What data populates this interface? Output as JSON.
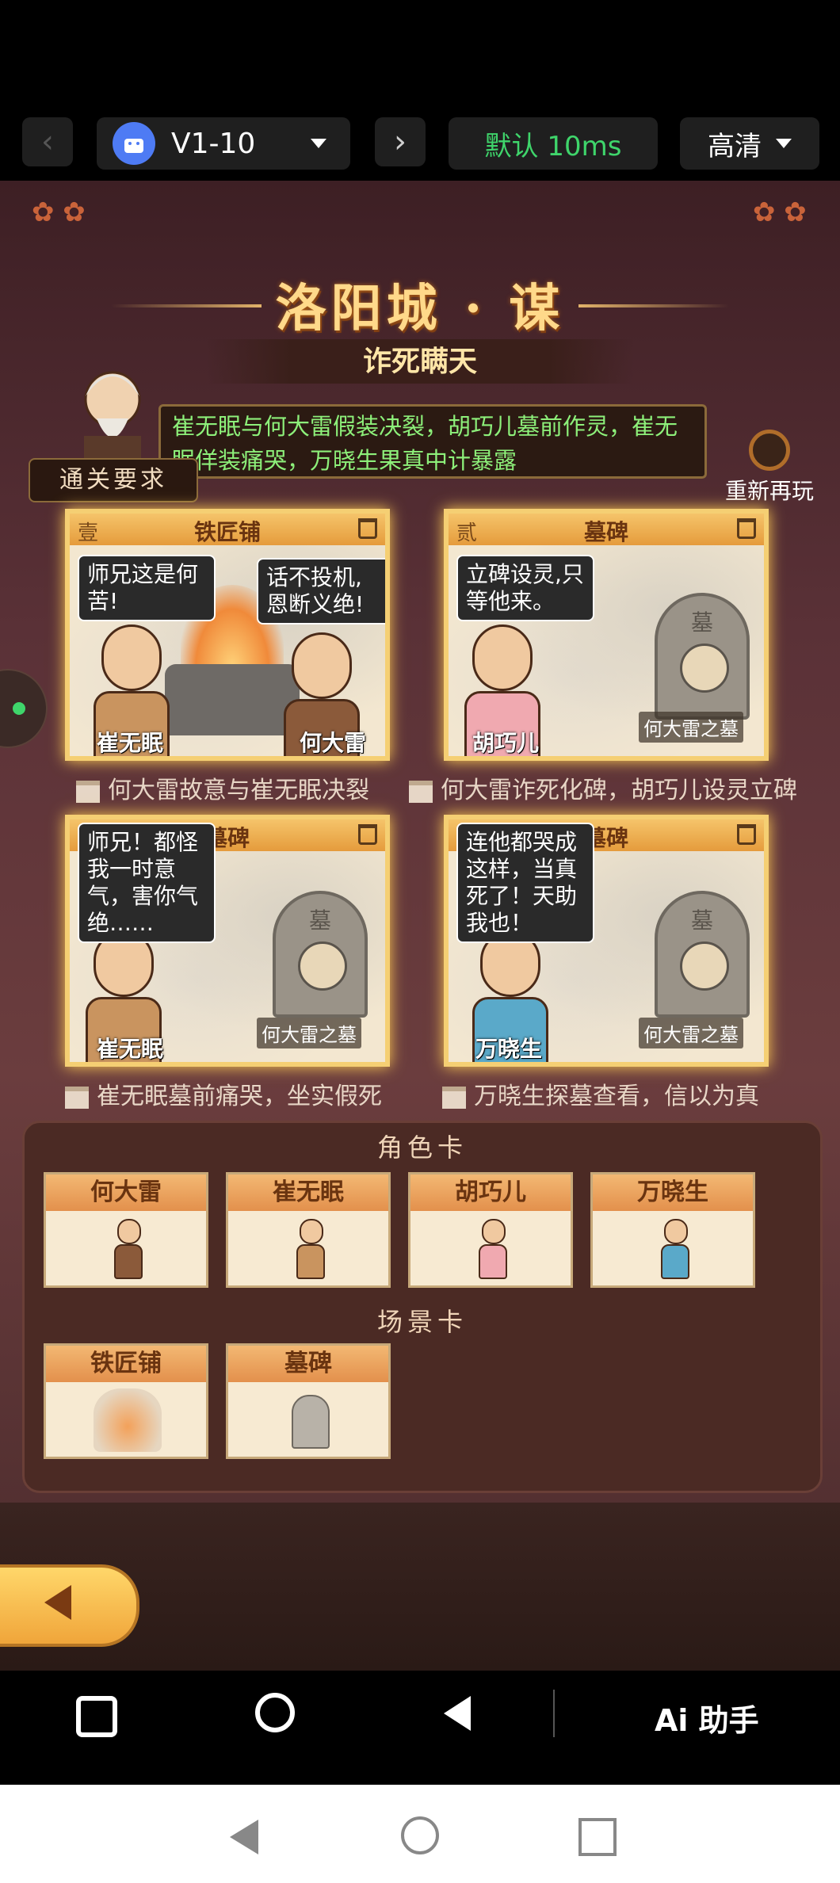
{
  "toolbar": {
    "device_label": "V1-10",
    "delay_label": "默认 10ms",
    "quality_label": "高清"
  },
  "level": {
    "title": "洛阳城 · 谋",
    "subtitle": "诈死瞒天",
    "mission_text": "崔无眠与何大雷假装决裂，胡巧儿墓前作灵，崔无眠佯装痛哭，万晓生果真中计暴露",
    "mission_label": "通关要求",
    "replay_label": "重新再玩"
  },
  "story_cards": [
    {
      "index": "壹",
      "scene": "铁匠铺",
      "bubbles": [
        "师兄这是何苦!",
        "话不投机,恩断义绝!"
      ],
      "names": [
        "崔无眠",
        "何大雷"
      ],
      "caption": "何大雷故意与崔无眠决裂"
    },
    {
      "index": "贰",
      "scene": "墓碑",
      "bubbles": [
        "立碑设灵,只等他来。"
      ],
      "names": [
        "胡巧儿"
      ],
      "tomb_plate": "何大雷之墓",
      "caption": "何大雷诈死化碑，胡巧儿设灵立碑"
    },
    {
      "index": "",
      "scene": "墓碑",
      "bubbles": [
        "师兄！都怪我一时意气，害你气绝……"
      ],
      "names": [
        "崔无眠"
      ],
      "tomb_plate": "何大雷之墓",
      "caption": "崔无眠墓前痛哭，坐实假死"
    },
    {
      "index": "",
      "scene": "墓碑",
      "bubbles": [
        "连他都哭成这样，当真死了！天助我也！"
      ],
      "names": [
        "万晓生"
      ],
      "tomb_plate": "何大雷之墓",
      "caption": "万晓生探墓查看，信以为真"
    }
  ],
  "tomb_title": "墓",
  "tray": {
    "role_title": "角色卡",
    "role_cards": [
      "何大雷",
      "崔无眠",
      "胡巧儿",
      "万晓生"
    ],
    "scene_title": "场景卡",
    "scene_cards": [
      "铁匠铺",
      "墓碑"
    ]
  },
  "navbar": {
    "assistant_label": "Ai 助手"
  },
  "colors": {
    "accent_gold": "#f5cf73",
    "mission_green": "#8df07a",
    "delay_green": "#3fd56b"
  }
}
